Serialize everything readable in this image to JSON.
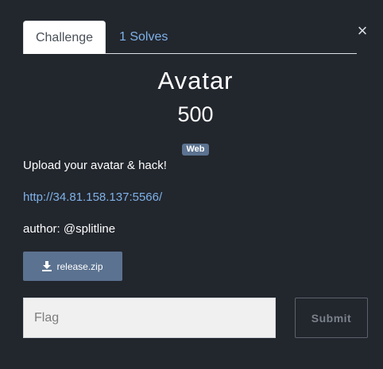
{
  "modal": {
    "close_icon": "×"
  },
  "tabs": [
    {
      "label": "Challenge",
      "active": true
    },
    {
      "label": "1 Solves",
      "active": false
    }
  ],
  "challenge": {
    "name": "Avatar",
    "value": "500",
    "category": "Web",
    "description": "Upload your avatar & hack!",
    "url": "http://34.81.158.137:5566/",
    "author": "author: @splitline"
  },
  "files": [
    {
      "label": "release.zip",
      "icon": "download-icon"
    }
  ],
  "flag": {
    "placeholder": "Flag",
    "value": ""
  },
  "submit": {
    "label": "Submit"
  },
  "colors": {
    "background": "#22262d",
    "accent": "#5b7290",
    "link": "#7eb1e8"
  }
}
